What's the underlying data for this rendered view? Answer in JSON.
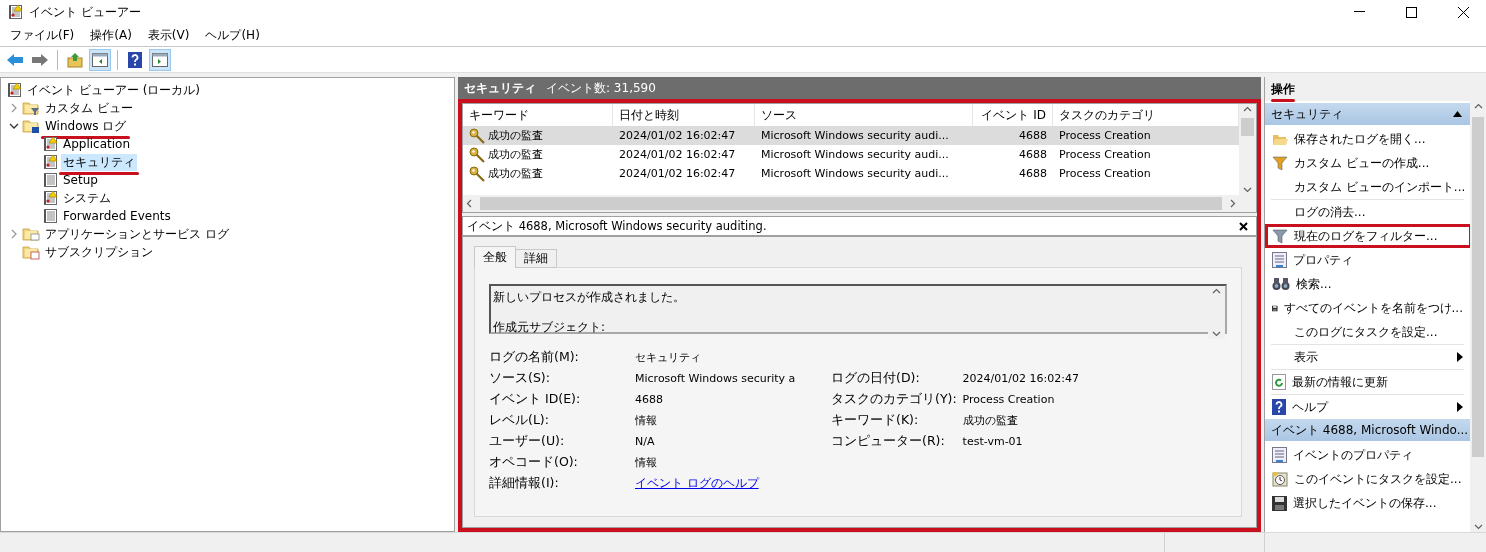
{
  "window": {
    "title": "イベント ビューアー"
  },
  "menu": [
    "ファイル(F)",
    "操作(A)",
    "表示(V)",
    "ヘルプ(H)"
  ],
  "toolbar": [
    {
      "kind": "back",
      "pressed": false
    },
    {
      "kind": "forward",
      "pressed": false
    },
    {
      "kind": "separator"
    },
    {
      "kind": "up",
      "pressed": false
    },
    {
      "kind": "tree-pane",
      "pressed": true
    },
    {
      "kind": "separator"
    },
    {
      "kind": "help",
      "pressed": false
    },
    {
      "kind": "action-pane",
      "pressed": true
    }
  ],
  "tree": [
    {
      "label": "イベント ビューアー (ローカル)",
      "kind": "root",
      "selected": false,
      "children": [
        {
          "label": "カスタム ビュー",
          "kind": "filter-folder",
          "expanded": false,
          "selected": false
        },
        {
          "label": "Windows ログ",
          "kind": "windows-folder",
          "expanded": true,
          "selected": false,
          "annotated": true,
          "children": [
            {
              "label": "Application",
              "kind": "log-warning",
              "selected": false
            },
            {
              "label": "セキュリティ",
              "kind": "log-warning",
              "selected": true,
              "annotated": true
            },
            {
              "label": "Setup",
              "kind": "log",
              "selected": false
            },
            {
              "label": "システム",
              "kind": "log-warning",
              "selected": false
            },
            {
              "label": "Forwarded Events",
              "kind": "log",
              "selected": false
            }
          ]
        },
        {
          "label": "アプリケーションとサービス ログ",
          "kind": "folder",
          "expanded": false,
          "selected": false
        },
        {
          "label": "サブスクリプション",
          "kind": "subscription-folder",
          "selected": false
        }
      ]
    }
  ],
  "center": {
    "title": "セキュリティ",
    "count": "イベント数: 31,590",
    "annotated": true,
    "table": {
      "columns": [
        "キーワード",
        "日付と時刻",
        "ソース",
        "イベント ID",
        "タスクのカテゴリ"
      ],
      "rows": [
        {
          "selected": true,
          "cells": [
            "成功の監査",
            "2024/01/02 16:02:47",
            "Microsoft Windows security audi...",
            "4688",
            "Process Creation"
          ]
        },
        {
          "selected": false,
          "cells": [
            "成功の監査",
            "2024/01/02 16:02:47",
            "Microsoft Windows security audi...",
            "4688",
            "Process Creation"
          ]
        },
        {
          "selected": false,
          "cells": [
            "成功の監査",
            "2024/01/02 16:02:47",
            "Microsoft Windows security audi...",
            "4688",
            "Process Creation"
          ]
        }
      ]
    },
    "detail": {
      "title": "イベント 4688, Microsoft Windows security auditing.",
      "tabs": [
        {
          "label": "全般",
          "selected": true
        },
        {
          "label": "詳細",
          "selected": false
        }
      ],
      "description": [
        "新しいプロセスが作成されました。",
        "作成元サブジェクト:"
      ],
      "rows": [
        {
          "left": {
            "label": "ログの名前(M):",
            "value": "セキュリティ",
            "kind": "text"
          }
        },
        {
          "left": {
            "label": "ソース(S):",
            "value": "Microsoft Windows security a",
            "kind": "text"
          },
          "right": {
            "label": "ログの日付(D):",
            "value": "2024/01/02 16:02:47"
          }
        },
        {
          "left": {
            "label": "イベント ID(E):",
            "value": "4688",
            "kind": "text"
          },
          "right": {
            "label": "タスクのカテゴリ(Y):",
            "value": "Process Creation"
          }
        },
        {
          "left": {
            "label": "レベル(L):",
            "value": "情報",
            "kind": "text"
          },
          "right": {
            "label": "キーワード(K):",
            "value": "成功の監査"
          }
        },
        {
          "left": {
            "label": "ユーザー(U):",
            "value": "N/A",
            "kind": "text"
          },
          "right": {
            "label": "コンピューター(R):",
            "value": "test-vm-01"
          }
        },
        {
          "left": {
            "label": "オペコード(O):",
            "value": "情報",
            "kind": "text"
          }
        },
        {
          "left": {
            "label": "詳細情報(I):",
            "value": "イベント ログのヘルプ",
            "kind": "link"
          }
        }
      ]
    }
  },
  "actions": {
    "title": "操作",
    "annotated": true,
    "sections": [
      {
        "title": "セキュリティ",
        "items": [
          {
            "label": "保存されたログを開く...",
            "kind": "open"
          },
          {
            "label": "カスタム ビューの作成...",
            "kind": "filter"
          },
          {
            "label": "カスタム ビューのインポート...",
            "kind": "none"
          },
          {
            "label": "ログの消去...",
            "kind": "none",
            "separator_before": true
          },
          {
            "label": "現在のログをフィルター...",
            "kind": "filter-plain",
            "annotated": true
          },
          {
            "label": "プロパティ",
            "kind": "properties"
          },
          {
            "label": "検索...",
            "kind": "find"
          },
          {
            "label": "すべてのイベントを名前をつけ...",
            "kind": "save"
          },
          {
            "label": "このログにタスクを設定...",
            "kind": "none"
          },
          {
            "label": "表示",
            "kind": "none",
            "separator_before": true,
            "submenu": true
          },
          {
            "label": "最新の情報に更新",
            "kind": "refresh",
            "separator_before": true
          },
          {
            "label": "ヘルプ",
            "kind": "help",
            "separator_before": true,
            "submenu": true
          }
        ]
      },
      {
        "title": "イベント 4688, Microsoft Windo...",
        "items": [
          {
            "label": "イベントのプロパティ",
            "kind": "properties"
          },
          {
            "label": "このイベントにタスクを設定...",
            "kind": "task"
          },
          {
            "label": "選択したイベントの保存...",
            "kind": "save"
          }
        ]
      }
    ]
  }
}
